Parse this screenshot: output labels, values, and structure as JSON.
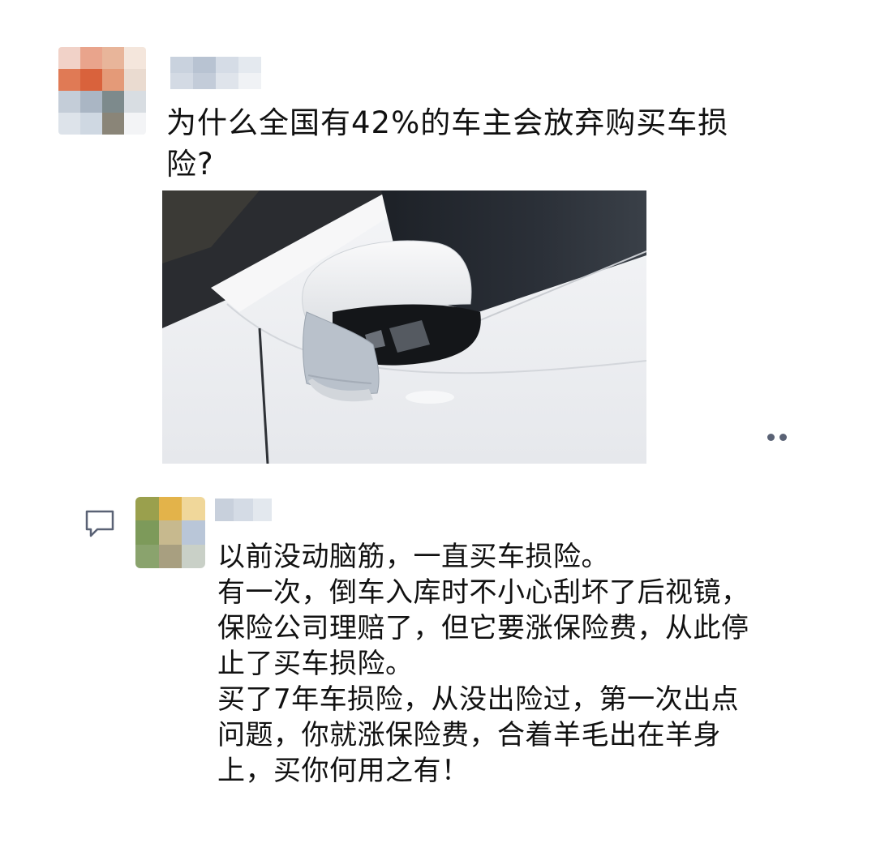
{
  "post": {
    "text_lines": [
      "为什么全国有42%的车主会放弃购买车损",
      "险?"
    ]
  },
  "reply": {
    "lines": [
      "以前没动脑筋，一直买车损险。",
      "有一次，倒车入库时不小心刮坏了后视镜，",
      "保险公司理赔了，但它要涨保险费，从此停",
      "止了买车损险。",
      "买了7年车损险，从没出险过，第一次出点",
      "问题，你就涨保险费，合着羊毛出在羊身",
      "上，买你何用之有！"
    ]
  },
  "icons": {
    "more": "more-dots-icon",
    "comment": "comment-bubble-icon"
  },
  "colors": {
    "text": "#111111",
    "icon": "#5a6275",
    "background": "#ffffff"
  }
}
